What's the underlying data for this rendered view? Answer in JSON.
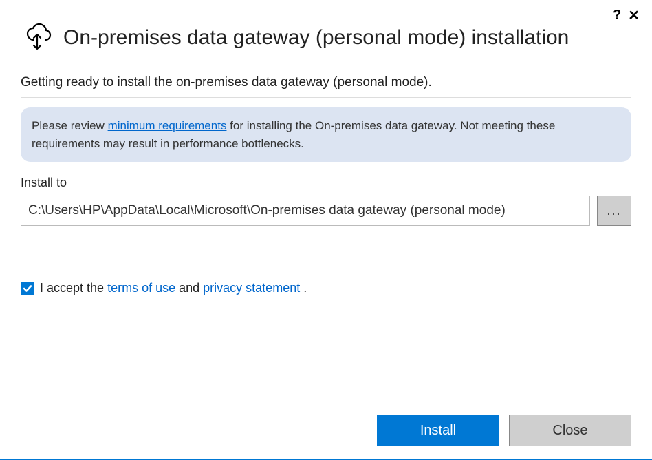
{
  "title": "On-premises data gateway (personal mode) installation",
  "subtitle": "Getting ready to install the on-premises data gateway (personal mode).",
  "info": {
    "prefix": "Please review ",
    "link": "minimum requirements",
    "suffix": " for installing the On-premises data gateway. Not meeting these requirements may result in performance bottlenecks."
  },
  "install": {
    "label": "Install to",
    "path": "C:\\Users\\HP\\AppData\\Local\\Microsoft\\On-premises data gateway (personal mode)",
    "browse": "..."
  },
  "terms": {
    "prefix": "I accept the ",
    "terms_link": "terms of use",
    "middle": " and ",
    "privacy_link": "privacy statement",
    "suffix": " .",
    "checked": true
  },
  "buttons": {
    "install": "Install",
    "close": "Close"
  }
}
